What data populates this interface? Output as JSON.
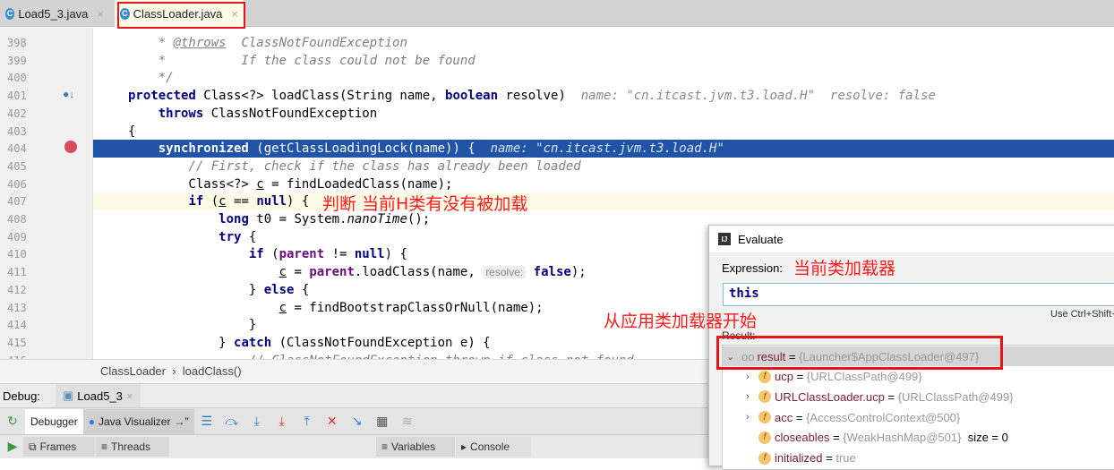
{
  "tabs": [
    {
      "label": "Load5_3.java",
      "icon": "java-class-run-icon"
    },
    {
      "label": "ClassLoader.java",
      "icon": "java-class-readonly-icon",
      "active": true
    }
  ],
  "editor": {
    "lines": [
      {
        "n": "398",
        "t": [
          [
            "    * ",
            "c"
          ],
          [
            "@throws",
            "c u"
          ],
          [
            "  ClassNotFoundException",
            "c"
          ]
        ]
      },
      {
        "n": "399",
        "t": [
          [
            "    *          If the class could not be found",
            "c"
          ]
        ]
      },
      {
        "n": "400",
        "t": [
          [
            "    */",
            "c"
          ]
        ]
      },
      {
        "n": "401",
        "t": [
          [
            "protected",
            "k"
          ],
          [
            " Class<?> loadClass(String name, ",
            ""
          ],
          [
            "boolean",
            "k"
          ],
          [
            " resolve)  ",
            ""
          ],
          [
            "name: \"cn.itcast.jvm.t3.load.H\"  resolve: false",
            "h"
          ]
        ]
      },
      {
        "n": "402",
        "t": [
          [
            "    ",
            ""
          ],
          [
            "throws",
            "k"
          ],
          [
            " ClassNotFoundException",
            ""
          ]
        ]
      },
      {
        "n": "403",
        "t": [
          [
            "{",
            ""
          ]
        ]
      },
      {
        "n": "404",
        "exec": true,
        "t": [
          [
            "    ",
            ""
          ],
          [
            "synchronized",
            "k"
          ],
          [
            " (getClassLoadingLock(name)) {  ",
            ""
          ],
          [
            "name: \"cn.itcast.jvm.t3.load.H\"",
            "h"
          ]
        ]
      },
      {
        "n": "405",
        "t": [
          [
            "        // First, check if the class has already been loaded",
            "c"
          ]
        ]
      },
      {
        "n": "406",
        "t": [
          [
            "        Class<?> ",
            ""
          ],
          [
            "c",
            "u"
          ],
          [
            " = findLoadedClass(name);",
            ""
          ]
        ]
      },
      {
        "n": "407",
        "cur": true,
        "t": [
          [
            "        ",
            ""
          ],
          [
            "if",
            "k"
          ],
          [
            " (",
            ""
          ],
          [
            "c",
            "u"
          ],
          [
            " == ",
            ""
          ],
          [
            "null",
            "k"
          ],
          [
            ") {",
            ""
          ]
        ]
      },
      {
        "n": "408",
        "t": [
          [
            "            ",
            ""
          ],
          [
            "long",
            "k"
          ],
          [
            " t0 = System.",
            ""
          ],
          [
            "nanoTime",
            "i"
          ],
          [
            "();",
            ""
          ]
        ]
      },
      {
        "n": "409",
        "t": [
          [
            "            ",
            ""
          ],
          [
            "try",
            "k"
          ],
          [
            " {",
            ""
          ]
        ]
      },
      {
        "n": "410",
        "t": [
          [
            "                ",
            ""
          ],
          [
            "if",
            "k"
          ],
          [
            " (",
            ""
          ],
          [
            "parent",
            "f"
          ],
          [
            " != ",
            ""
          ],
          [
            "null",
            "k"
          ],
          [
            ") {",
            ""
          ]
        ]
      },
      {
        "n": "411",
        "t": [
          [
            "                    ",
            ""
          ],
          [
            "c",
            "u"
          ],
          [
            " = ",
            ""
          ],
          [
            "parent",
            "f"
          ],
          [
            ".loadClass(name, ",
            ""
          ],
          [
            "resolve:",
            "hint"
          ],
          [
            " ",
            ""
          ],
          [
            "false",
            "k"
          ],
          [
            ");",
            ""
          ]
        ]
      },
      {
        "n": "412",
        "t": [
          [
            "                } ",
            ""
          ],
          [
            "else",
            "k"
          ],
          [
            " {",
            ""
          ]
        ]
      },
      {
        "n": "413",
        "t": [
          [
            "                    ",
            ""
          ],
          [
            "c",
            "u"
          ],
          [
            " = findBootstrapClassOrNull(name);",
            ""
          ]
        ]
      },
      {
        "n": "414",
        "t": [
          [
            "                }",
            ""
          ]
        ]
      },
      {
        "n": "415",
        "t": [
          [
            "            } ",
            ""
          ],
          [
            "catch",
            "k"
          ],
          [
            " (ClassNotFoundException e) {",
            ""
          ]
        ]
      },
      {
        "n": "416",
        "t": [
          [
            "                // ClassNotFoundException thrown if class not found",
            "c"
          ]
        ]
      }
    ]
  },
  "annotations": {
    "line407": "判断 当前H类有没有被加载",
    "expression": "当前类加载器",
    "result": "从应用类加载器开始"
  },
  "breadcrumb": [
    "ClassLoader",
    "loadClass()"
  ],
  "debug": {
    "label": "Debug:",
    "session": "Load5_3"
  },
  "toolbar": {
    "debugger": "Debugger",
    "visualizer": "Java Visualizer"
  },
  "panes": {
    "frames": "Frames",
    "threads": "Threads",
    "variables": "Variables",
    "console": "Console"
  },
  "evaluate": {
    "title": "Evaluate",
    "expression_label": "Expression:",
    "expression": "this",
    "hint": "Use Ctrl+Shift+",
    "result_label": "Result:",
    "rows": [
      {
        "name": "result",
        "eq": " = ",
        "value": "{Launcher$AppClassLoader@497}",
        "expanded": true,
        "level": 0
      },
      {
        "name": "ucp",
        "eq": " = ",
        "value": "{URLClassPath@499}",
        "level": 1,
        "arrow": true
      },
      {
        "name": "URLClassLoader.ucp",
        "eq": " = ",
        "value": "{URLClassPath@499}",
        "level": 1,
        "arrow": true
      },
      {
        "name": "acc",
        "eq": " = ",
        "value": "{AccessControlContext@500}",
        "level": 1,
        "arrow": true
      },
      {
        "name": "closeables",
        "eq": " = ",
        "value": "{WeakHashMap@501}",
        "extra": "  size = 0",
        "level": 1
      },
      {
        "name": "initialized",
        "eq": " = ",
        "value": "true",
        "level": 1
      }
    ]
  },
  "colors": {
    "highlight_box": "#e8141c",
    "exec_line": "#2154a6",
    "annotation": "#ff1a1a"
  }
}
